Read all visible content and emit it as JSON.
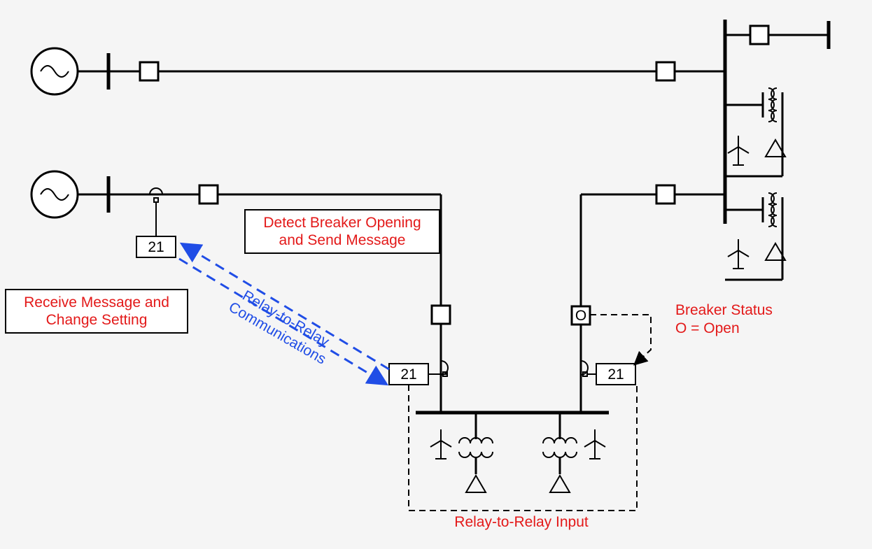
{
  "relays": {
    "left_21": "21",
    "mid_21": "21",
    "right_21": "21"
  },
  "labels": {
    "receive_message_l1": "Receive Message and",
    "receive_message_l2": "Change Setting",
    "detect_breaker_l1": "Detect Breaker Opening",
    "detect_breaker_l2": "and Send Message",
    "relay_comm_l1": "Relay-to-Relay",
    "relay_comm_l2": "Communications",
    "breaker_status_l1": "Breaker Status",
    "breaker_status_l2": "O = Open",
    "relay_input": "Relay-to-Relay Input",
    "open_symbol": "O"
  }
}
